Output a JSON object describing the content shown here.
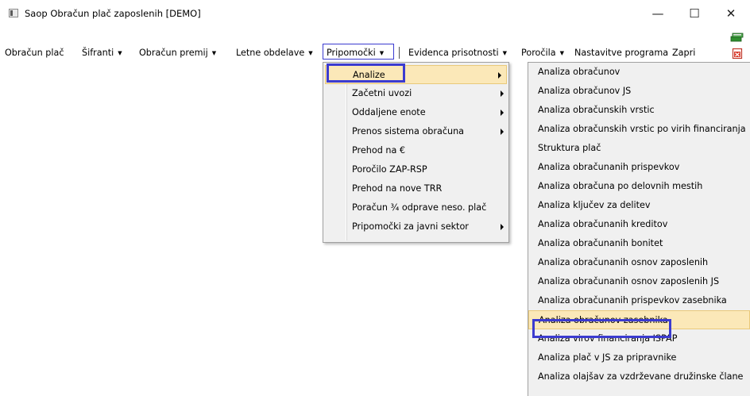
{
  "window": {
    "title": "Saop Obračun plač zaposlenih  [DEMO]",
    "minimize": "—",
    "maximize": "☐",
    "close": "✕"
  },
  "menubar": {
    "items": [
      {
        "label": "Obračun plač"
      },
      {
        "label": "Šifranti"
      },
      {
        "label": "Obračun premij"
      },
      {
        "label": "Letne obdelave"
      },
      {
        "label": "Pripomočki"
      },
      {
        "label": "Evidenca prisotnosti"
      },
      {
        "label": "Poročila"
      },
      {
        "label": "Nastavitve programa"
      },
      {
        "label": "Zapri"
      }
    ],
    "arrow": "▼",
    "icons": [
      "books-icon",
      "exit-icon"
    ]
  },
  "pripomocki_menu": {
    "items": [
      {
        "label": "Analize",
        "submenu": true,
        "selected": true
      },
      {
        "label": "Začetni uvozi",
        "submenu": true
      },
      {
        "label": "Oddaljene enote",
        "submenu": true
      },
      {
        "label": "Prenos sistema obračuna",
        "submenu": true
      },
      {
        "label": "Prehod na €",
        "submenu": false
      },
      {
        "label": "Poročilo ZAP-RSP",
        "submenu": false
      },
      {
        "label": "Prehod na nove TRR",
        "submenu": false
      },
      {
        "label": "Poračun ¾ odprave neso. plač",
        "submenu": false
      },
      {
        "label": "Pripomočki za javni sektor",
        "submenu": true
      }
    ]
  },
  "analize_menu": {
    "items": [
      {
        "label": "Analiza obračunov"
      },
      {
        "label": "Analiza obračunov JS"
      },
      {
        "label": "Analiza obračunskih vrstic"
      },
      {
        "label": "Analiza obračunskih vrstic po virih financiranja"
      },
      {
        "label": "Struktura plač"
      },
      {
        "label": "Analiza obračunanih prispevkov"
      },
      {
        "label": "Analiza obračuna po delovnih mestih"
      },
      {
        "label": "Analiza ključev za delitev"
      },
      {
        "label": "Analiza obračunanih kreditov"
      },
      {
        "label": "Analiza obračunanih bonitet"
      },
      {
        "label": "Analiza obračunanih osnov zaposlenih"
      },
      {
        "label": "Analiza obračunanih osnov zaposlenih JS"
      },
      {
        "label": "Analiza obračunanih prispevkov zasebnika"
      },
      {
        "label": "Analiza obračunov zasebnika",
        "selected": true
      },
      {
        "label": "Analiza virov financiranja ISPAP"
      },
      {
        "label": "Analiza plač v JS za pripravnike"
      },
      {
        "label": "Analiza olajšav za vzdrževane družinske člane"
      }
    ]
  },
  "colors": {
    "highlight": "#fbe8b8",
    "selection_frame": "#3b3bd0",
    "menu_bg": "#f0f0f0"
  }
}
